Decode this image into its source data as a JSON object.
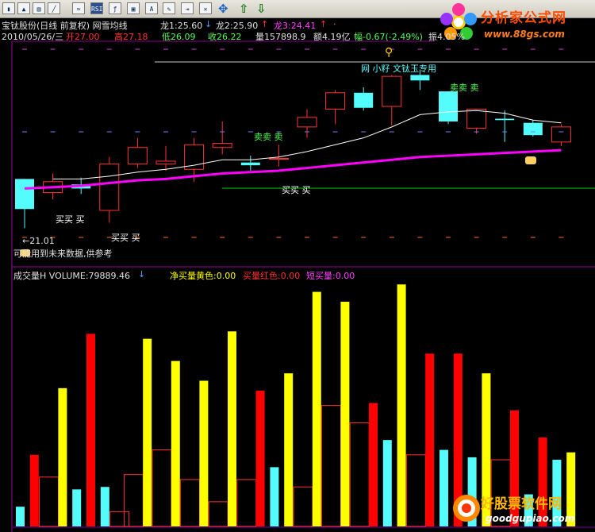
{
  "stock": {
    "name_line": "宝钛股份(日线 前复权) 网雪均线",
    "long1": "龙1:25.60",
    "long2": "龙2:25.90",
    "long3": "龙3:24.41",
    "long3_dot": "·"
  },
  "ohlc": {
    "date": "2010/05/26/三",
    "open_label": "开27.00",
    "high_label": "高27.18",
    "low_label": "低26.09",
    "close_label": "收26.22",
    "volume_label": "量157898.9",
    "amount_label": "额4.19亿",
    "change_label": "幅-0.67(-2.49%)",
    "amplitude_label": "振4.05%",
    "extra": "换"
  },
  "annotations": {
    "low_price": "←21.01",
    "future_data_note": "可能用到未来数据,供参考",
    "top_marker": "网 小籽 文钛玉专用",
    "buy_signal": "买买 买",
    "sell_signal": "卖卖 卖"
  },
  "volume_panel": {
    "title": "成交量H VOLUME:79889.46",
    "net_buy": "净买量黄色:0.00",
    "buy_red": "买量红色:0.00",
    "short_buy": "短买量:0.00"
  },
  "logo_top": {
    "title": "分析家公式网",
    "url": "www.88gs.com"
  },
  "logo_bottom": {
    "title": "好股票软件网",
    "url": "goodgupiao.com"
  },
  "colors": {
    "up": "#ff3232",
    "down": "#54fcfc",
    "ma_white": "#ffffff",
    "ma_magenta": "#ff00ff",
    "yellow": "#ffff00",
    "red_bar": "#ff0000"
  },
  "candles": [
    {
      "o": 24.6,
      "c": 22.4,
      "h": 24.6,
      "l": 21.0
    },
    {
      "o": 23.6,
      "c": 24.4,
      "h": 25.0,
      "l": 23.1
    },
    {
      "o": 24.2,
      "c": 23.9,
      "h": 24.7,
      "l": 23.5
    },
    {
      "o": 22.3,
      "c": 25.7,
      "h": 26.2,
      "l": 21.4
    },
    {
      "o": 25.7,
      "c": 26.9,
      "h": 27.6,
      "l": 25.4
    },
    {
      "o": 25.7,
      "c": 25.9,
      "h": 27.0,
      "l": 25.2
    },
    {
      "o": 25.3,
      "c": 27.1,
      "h": 27.6,
      "l": 24.4
    },
    {
      "o": 26.9,
      "c": 27.2,
      "h": 28.8,
      "l": 26.4
    },
    {
      "o": 25.8,
      "c": 25.6,
      "h": 26.3,
      "l": 25.2
    },
    {
      "o": 26.1,
      "c": 26.1,
      "h": 27.1,
      "l": 25.5
    },
    {
      "o": 28.4,
      "c": 29.1,
      "h": 29.7,
      "l": 27.6
    },
    {
      "o": 29.7,
      "c": 30.9,
      "h": 31.1,
      "l": 28.6
    },
    {
      "o": 30.9,
      "c": 29.8,
      "h": 31.3,
      "l": 29.6
    },
    {
      "o": 29.9,
      "c": 32.1,
      "h": 32.2,
      "l": 28.5
    },
    {
      "o": 32.2,
      "c": 31.8,
      "h": 32.6,
      "l": 31.1
    },
    {
      "o": 31.0,
      "c": 28.8,
      "h": 31.0,
      "l": 28.6
    },
    {
      "o": 28.3,
      "c": 29.7,
      "h": 29.7,
      "l": 27.9
    },
    {
      "o": 29.0,
      "c": 28.9,
      "h": 29.6,
      "l": 27.3
    },
    {
      "o": 28.7,
      "c": 27.8,
      "h": 28.9,
      "l": 27.7
    },
    {
      "o": 27.3,
      "c": 28.4,
      "h": 28.6,
      "l": 27.0
    }
  ],
  "ma_white": [
    24.2,
    24.6,
    24.6,
    24.8,
    25.1,
    25.3,
    25.6,
    26.0,
    26.0,
    26.2,
    26.6,
    27.1,
    27.6,
    28.4,
    29.3,
    29.5,
    29.6,
    29.4,
    28.9,
    28.7
  ],
  "ma_magenta": [
    23.9,
    24.0,
    24.1,
    24.3,
    24.5,
    24.6,
    24.8,
    25.0,
    25.1,
    25.2,
    25.4,
    25.6,
    25.8,
    26.0,
    26.2,
    26.3,
    26.4,
    26.5,
    26.6,
    26.7
  ],
  "volumes": [
    {
      "red": 0.0,
      "yellow": 0.0,
      "cyan": 0.2,
      "outline": 0.0
    },
    {
      "red": 0.71,
      "yellow": 0.0,
      "cyan": 0.0,
      "outline": 0.0
    },
    {
      "red": 0.0,
      "yellow": 0.0,
      "cyan": 0.0,
      "outline": 0.51
    },
    {
      "red": 0.0,
      "yellow": 0.0,
      "cyan": 0.37,
      "outline": 0.0
    },
    {
      "red": 0.0,
      "yellow": 0.0,
      "cyan": 0.36,
      "outline": 0.0
    },
    {
      "red": 0.0,
      "yellow": 0.0,
      "cyan": 0.0,
      "outline": 0.64
    },
    {
      "red": 0.0,
      "yellow": 0.0,
      "cyan": 0.0,
      "outline": 0.71
    },
    {
      "red": 0.0,
      "yellow": 0.0,
      "cyan": 0.0,
      "outline": 0.53
    },
    {
      "red": 0.0,
      "yellow": 0.0,
      "cyan": 0.0,
      "outline": 0.85
    },
    {
      "red": 0.0,
      "yellow": 0.0,
      "cyan": 0.0,
      "outline": 0.93
    },
    {
      "red": 0.0,
      "yellow": 0.0,
      "cyan": 0.0,
      "outline": 0.91
    },
    {
      "red": 0.0,
      "yellow": 0.0,
      "cyan": 0.0,
      "outline": 0.99
    },
    {
      "red": 0.0,
      "yellow": 0.0,
      "cyan": 0.0,
      "outline": 0.72
    },
    {
      "red": 0.0,
      "yellow": 0.0,
      "cyan": 0.0,
      "outline": 0.58
    },
    {
      "red": 0.0,
      "yellow": 0.0,
      "cyan": 0.0,
      "outline": 0.71
    },
    {
      "red": 0.0,
      "yellow": 0.0,
      "cyan": 0.0,
      "outline": 0.66
    },
    {
      "red": 0.0,
      "yellow": 0.0,
      "cyan": 0.0,
      "outline": 0.52
    },
    {
      "red": 0.0,
      "yellow": 0.0,
      "cyan": 0.0,
      "outline": 0.41
    },
    {
      "red": 0.0,
      "yellow": 0.0,
      "cyan": 0.0,
      "outline": 0.27
    },
    {
      "red": 0.0,
      "yellow": 0.0,
      "cyan": 0.0,
      "outline": 0.22
    }
  ],
  "volbars": [
    {
      "kind": "cyan",
      "h": 0.08
    },
    {
      "kind": "red",
      "h": 0.29
    },
    {
      "kind": "outline",
      "h": 0.2
    },
    {
      "kind": "yellow",
      "h": 0.56
    },
    {
      "kind": "cyan",
      "h": 0.15
    },
    {
      "kind": "red",
      "h": 0.78
    },
    {
      "kind": "cyan",
      "h": 0.16
    },
    {
      "kind": "outline",
      "h": 0.06
    },
    {
      "kind": "outline",
      "h": 0.21
    },
    {
      "kind": "yellow",
      "h": 0.76
    },
    {
      "kind": "outline",
      "h": 0.31
    },
    {
      "kind": "yellow",
      "h": 0.67
    },
    {
      "kind": "outline",
      "h": 0.19
    },
    {
      "kind": "yellow",
      "h": 0.59
    },
    {
      "kind": "outline",
      "h": 0.1
    },
    {
      "kind": "yellow",
      "h": 0.79
    },
    {
      "kind": "outline",
      "h": 0.19
    },
    {
      "kind": "red",
      "h": 0.55
    },
    {
      "kind": "cyan",
      "h": 0.24
    },
    {
      "kind": "yellow",
      "h": 0.62
    },
    {
      "kind": "outline",
      "h": 0.16
    },
    {
      "kind": "yellow",
      "h": 0.95
    },
    {
      "kind": "outline",
      "h": 0.49
    },
    {
      "kind": "yellow",
      "h": 0.91
    },
    {
      "kind": "outline",
      "h": 0.42
    },
    {
      "kind": "red",
      "h": 0.5
    },
    {
      "kind": "cyan",
      "h": 0.35
    },
    {
      "kind": "yellow",
      "h": 0.98
    },
    {
      "kind": "outline",
      "h": 0.29
    },
    {
      "kind": "red",
      "h": 0.7
    },
    {
      "kind": "cyan",
      "h": 0.31
    },
    {
      "kind": "red",
      "h": 0.7
    },
    {
      "kind": "cyan",
      "h": 0.28
    },
    {
      "kind": "yellow",
      "h": 0.62
    },
    {
      "kind": "outline",
      "h": 0.27
    },
    {
      "kind": "red",
      "h": 0.47
    },
    {
      "kind": "cyan",
      "h": 0.13
    },
    {
      "kind": "red",
      "h": 0.36
    },
    {
      "kind": "cyan",
      "h": 0.27
    },
    {
      "kind": "yellow",
      "h": 0.3
    }
  ]
}
